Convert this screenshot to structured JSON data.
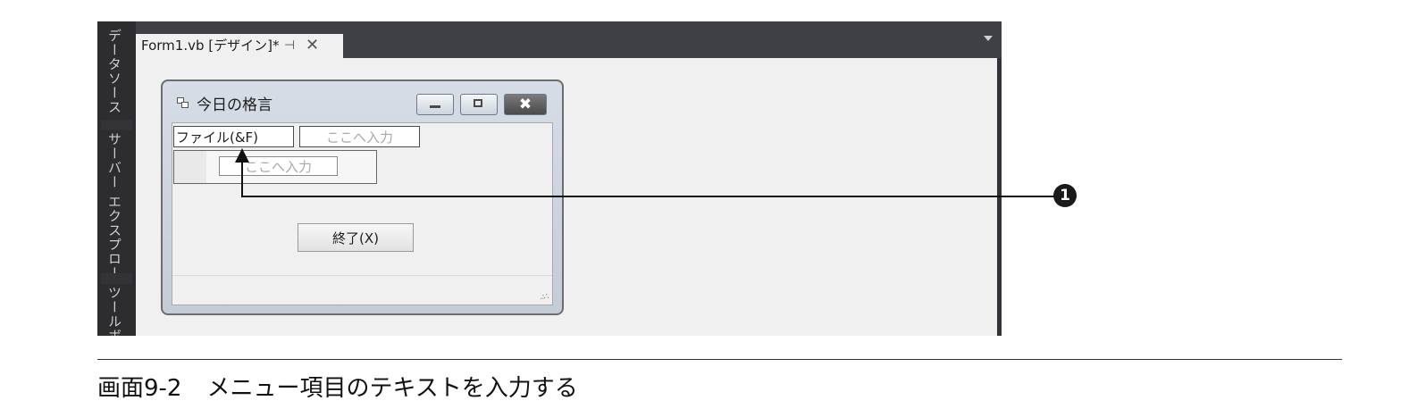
{
  "ide": {
    "side_tabs": [
      "データソース",
      "サーバー エクスプローラー",
      "ツールボ"
    ],
    "document_tab": {
      "title": "Form1.vb [デザイン]*",
      "pin_glyph": "⊣",
      "close_glyph": "✕"
    }
  },
  "form": {
    "title": "今日の格言",
    "close_glyph": "✖",
    "menu": {
      "file_item": "ファイル(&F)",
      "type_here_top": "ここへ入力",
      "type_here_sub": "ここへ入力"
    },
    "exit_button_label": "終了(X)"
  },
  "callout": {
    "badge": "1"
  },
  "caption": {
    "number": "画面9-2",
    "text": "メニュー項目のテキストを入力する"
  }
}
